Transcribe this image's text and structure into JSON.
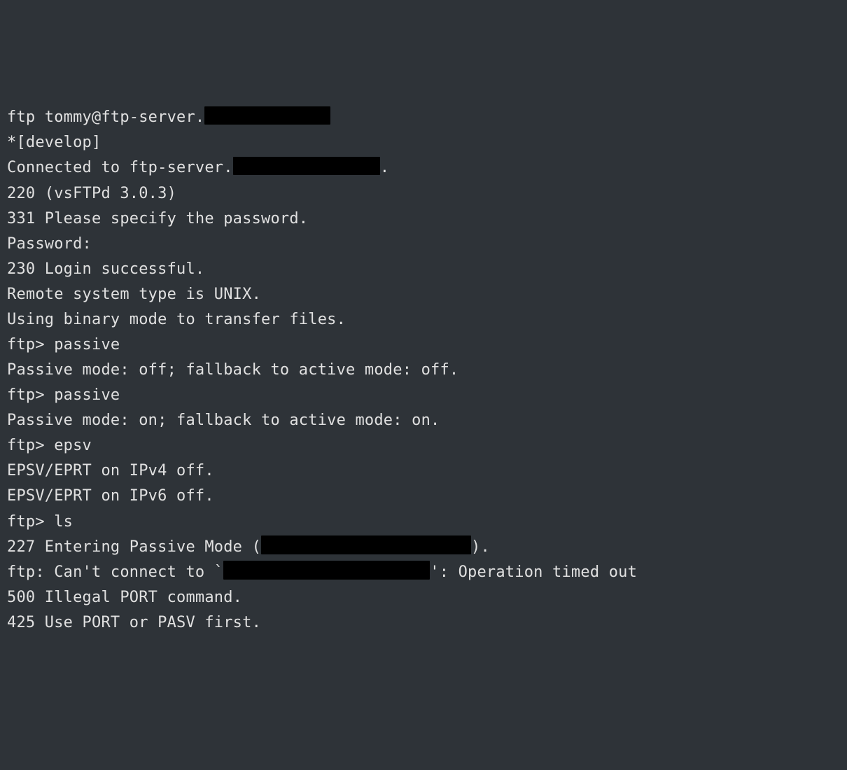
{
  "lines": {
    "l1a": "ftp tommy@ftp-server.",
    "l2": "*[develop]",
    "l3a": "Connected to ftp-server.",
    "l3b": ".",
    "l4": "220 (vsFTPd 3.0.3)",
    "l5": "331 Please specify the password.",
    "l6": "Password:",
    "l7": "230 Login successful.",
    "l8": "Remote system type is UNIX.",
    "l9": "Using binary mode to transfer files.",
    "l10": "ftp> passive",
    "l11": "Passive mode: off; fallback to active mode: off.",
    "l12": "ftp> passive",
    "l13": "Passive mode: on; fallback to active mode: on.",
    "l14": "ftp> epsv",
    "l15": "EPSV/EPRT on IPv4 off.",
    "l16": "EPSV/EPRT on IPv6 off.",
    "l17": "ftp> ls",
    "l18a": "227 Entering Passive Mode (",
    "l18b": ").",
    "l19a": "ftp: Can't connect to `",
    "l19b": "': Operation timed out",
    "l20": "500 Illegal PORT command.",
    "l21": "425 Use PORT or PASV first."
  }
}
